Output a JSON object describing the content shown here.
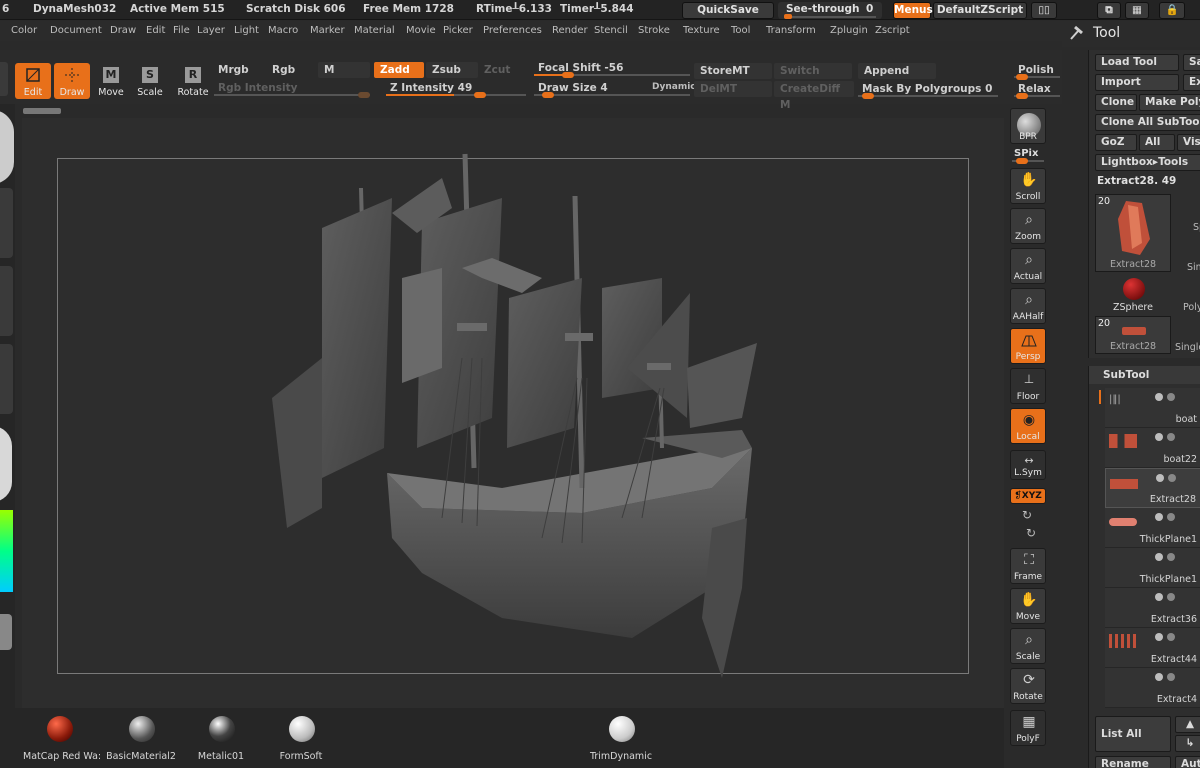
{
  "status": {
    "mesh_name": "DynaMesh032",
    "active_mem": "Active Mem 515",
    "scratch_disk": "Scratch Disk 606",
    "free_mem": "Free Mem 1728",
    "rtime": "RTime┸6.133",
    "timer": "Timer┸5.844",
    "left_fragment": "6"
  },
  "topbuttons": {
    "quicksave": "QuickSave",
    "seethrough_label": "See-through",
    "seethrough_value": "0",
    "menus": "Menus",
    "script": "DefaultZScript"
  },
  "menus": [
    "Color",
    "Document",
    "Draw",
    "Edit",
    "File",
    "Layer",
    "Light",
    "Macro",
    "Marker",
    "Material",
    "Movie",
    "Picker",
    "Preferences",
    "Render",
    "Stencil",
    "Stroke",
    "Texture",
    "Tool",
    "Transform",
    "Zplugin",
    "Zscript"
  ],
  "tool_panel_title": "Tool",
  "shelf": {
    "edit": "Edit",
    "draw": "Draw",
    "move": "Move",
    "scale": "Scale",
    "rotate": "Rotate",
    "mrgb": "Mrgb",
    "rgb": "Rgb",
    "m": "M",
    "zadd": "Zadd",
    "zsub": "Zsub",
    "zcut": "Zcut",
    "rgb_intensity": "Rgb Intensity",
    "z_intensity": "Z Intensity 49",
    "focal_shift": "Focal Shift -56",
    "draw_size": "Draw Size 4",
    "dynamic": "Dynamic",
    "storemt": "StoreMT",
    "switch": "Switch",
    "delmt": "DelMT",
    "creatediff": "CreateDiff M",
    "append": "Append",
    "mask_polygroups": "Mask By Polygroups 0",
    "polish": "Polish",
    "relax": "Relax"
  },
  "right_strip": {
    "bpr": "BPR",
    "spix": "SPix",
    "scroll": "Scroll",
    "zoom": "Zoom",
    "actual": "Actual",
    "aahalf": "AAHalf",
    "persp": "Persp",
    "floor": "Floor",
    "local": "Local",
    "lsym": "L.Sym",
    "xyz": "❡XYZ",
    "frame": "Frame",
    "move": "Move",
    "scale": "Scale",
    "rotate": "Rotate",
    "polyf": "PolyF"
  },
  "materials": [
    "MatCap Red Wa:",
    "BasicMaterial2",
    "Metalic01",
    "FormSoft",
    "TrimDynamic"
  ],
  "tool_palette": {
    "load_tool": "Load Tool",
    "save": "Save",
    "import": "Import",
    "export": "Expo",
    "clone": "Clone",
    "make_poly": "Make PolyM",
    "clone_all": "Clone All SubTools",
    "goz": "GoZ",
    "all": "All",
    "visible": "Visib",
    "lightbox": "Lightbox▸Tools",
    "current_tool": "Extract28. 49",
    "thumb1_count": "20",
    "thumb1_name": "Extract28",
    "thumb2_name": "ZSphere",
    "thumb3_count": "20",
    "thumb3_name": "Extract28",
    "side1": "Sp",
    "side2": "Sim",
    "side3": "Poly",
    "side4": "Single"
  },
  "subtool": {
    "title": "SubTool",
    "items": [
      "boat",
      "boat22",
      "Extract28",
      "ThickPlane1",
      "ThickPlane1",
      "Extract36",
      "Extract44",
      "Extract4"
    ],
    "list_all": "List All",
    "rename": "Rename",
    "auto": "Auto"
  }
}
